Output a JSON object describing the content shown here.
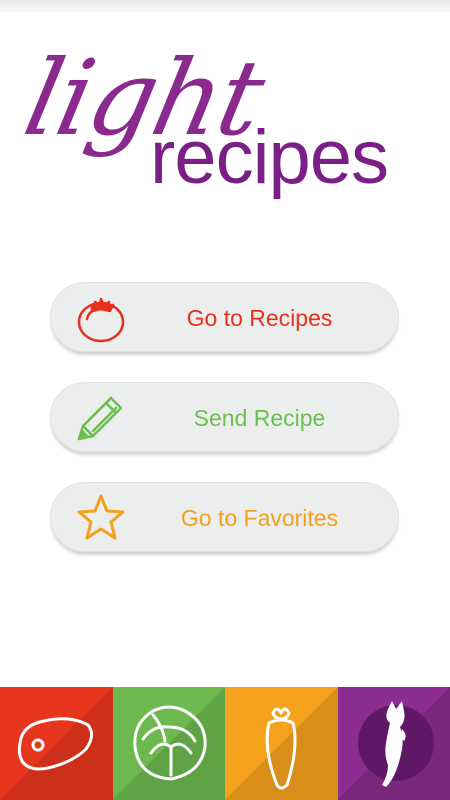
{
  "logo": {
    "word1": "light",
    "word2": "recipes",
    "color": "#8a2a8f"
  },
  "menu": [
    {
      "label": "Go to Recipes",
      "icon": "tomato-icon",
      "color": "#e8301c"
    },
    {
      "label": "Send Recipe",
      "icon": "pencil-icon",
      "color": "#6bbf4e"
    },
    {
      "label": "Go to Favorites",
      "icon": "star-icon",
      "color": "#f3a01f"
    }
  ],
  "bottom_bar": [
    {
      "icon": "meat-icon",
      "color": "#e8351d"
    },
    {
      "icon": "cabbage-icon",
      "color": "#6db94f"
    },
    {
      "icon": "carrot-icon",
      "color": "#f7a21c"
    },
    {
      "icon": "cat-icon",
      "color": "#8b2c90"
    }
  ]
}
